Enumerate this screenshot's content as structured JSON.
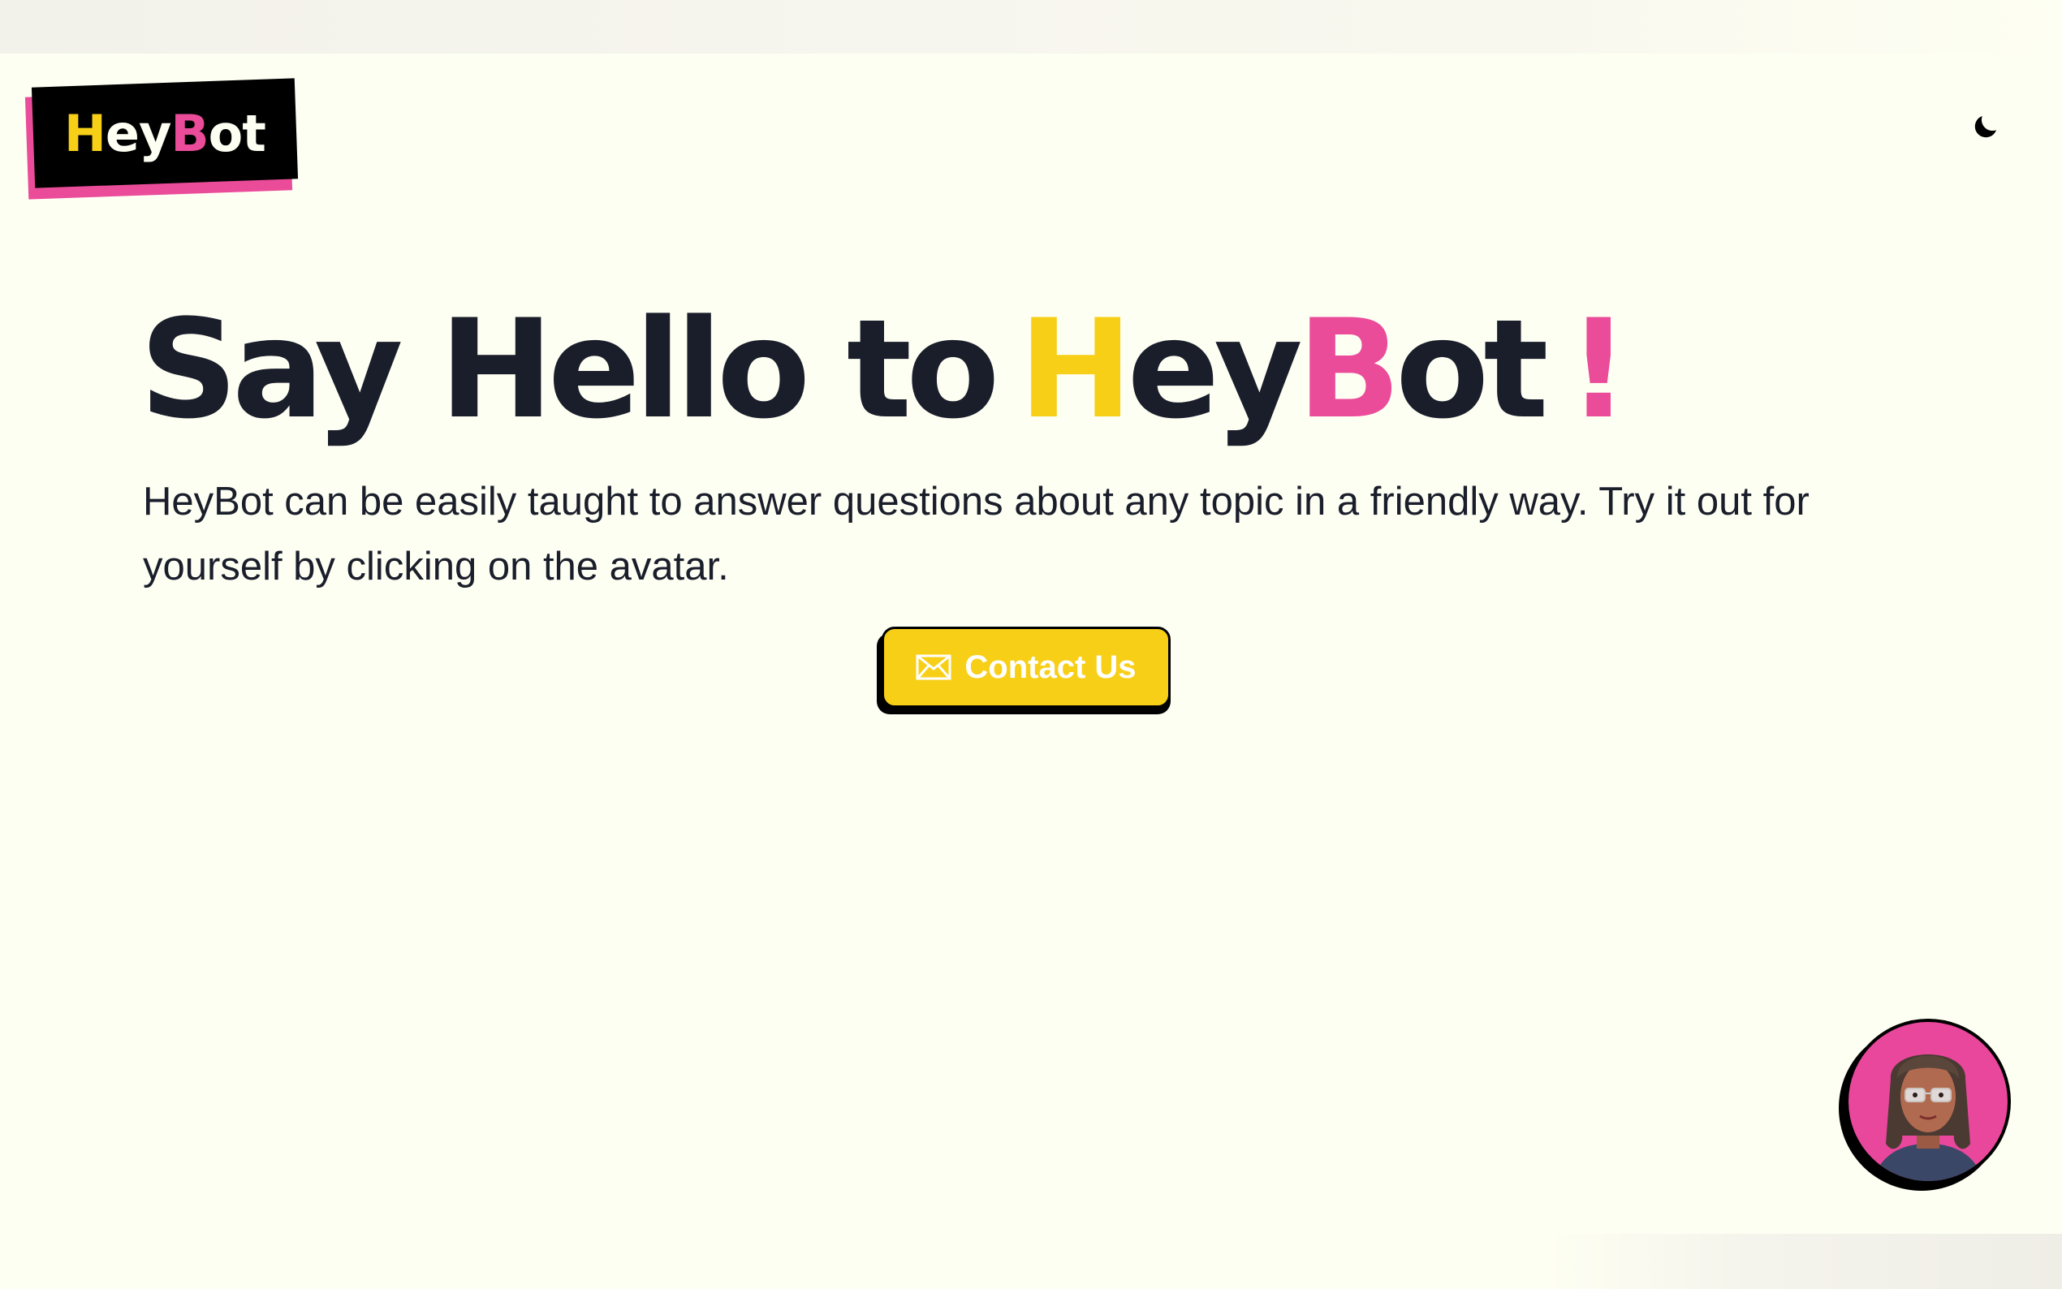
{
  "header": {
    "logo": {
      "part1": "H",
      "part2": "ey",
      "part3": "B",
      "part4": "ot"
    },
    "theme_toggle_icon": "moon-icon"
  },
  "hero": {
    "title_prefix": "Say Hello to",
    "title_h": "H",
    "title_ey": "ey",
    "title_b": "B",
    "title_ot": "ot",
    "title_exclaim": "!",
    "description": "HeyBot can be easily taught to answer questions about any topic in a friendly way. Try it out for yourself by clicking on the avatar.",
    "contact_button": {
      "label": "Contact Us",
      "icon": "envelope-icon"
    }
  },
  "avatar": {
    "icon": "avatar-portrait"
  },
  "colors": {
    "background": "#fefff3",
    "text": "#1a1e2b",
    "yellow": "#f8cf17",
    "pink": "#ea4c9a",
    "black": "#000000"
  }
}
